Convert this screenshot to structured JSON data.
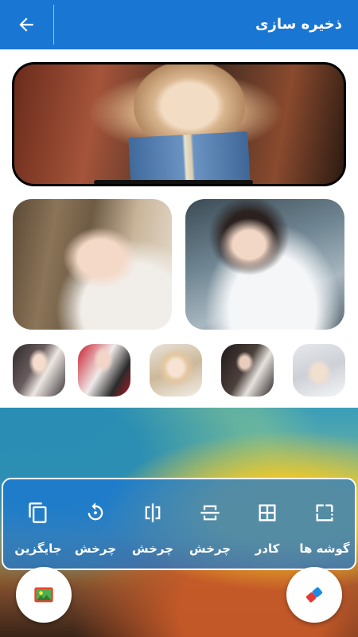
{
  "appbar": {
    "title": "ذخیره سازی",
    "back_icon": "arrow-left-icon"
  },
  "colors": {
    "primary": "#1976d2",
    "toolbar_bg": "#1976d2cc",
    "white": "#ffffff"
  },
  "collage": {
    "photos": [
      {
        "name": "collage-photo-top"
      },
      {
        "name": "collage-photo-left"
      },
      {
        "name": "collage-photo-right"
      }
    ],
    "thumbnails": [
      "thumbnail-1",
      "thumbnail-2",
      "thumbnail-3",
      "thumbnail-4",
      "thumbnail-5"
    ]
  },
  "toolbar": {
    "items": [
      {
        "label": "گوشه ها",
        "icon": "rounded-corners-icon"
      },
      {
        "label": "کادر",
        "icon": "grid-frame-icon"
      },
      {
        "label": "چرخش",
        "icon": "flip-horizontal-icon"
      },
      {
        "label": "چرخش",
        "icon": "flip-vertical-icon"
      },
      {
        "label": "چرخش",
        "icon": "rotate-icon"
      },
      {
        "label": "جایگزین",
        "icon": "replace-copy-icon"
      }
    ]
  },
  "fabs": {
    "left_icon": "gallery-image-icon",
    "right_icon": "eraser-icon"
  }
}
